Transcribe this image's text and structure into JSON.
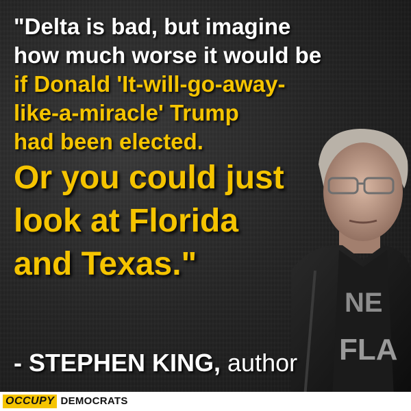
{
  "quote": {
    "lines": [
      "\"Delta is bad, but imagine",
      "how much worse it would be",
      "if Donald 'It-will-go-away-",
      "like-a-miracle' Trump",
      "had been elected."
    ],
    "emphasis": [
      "Or you could just",
      "look at Florida",
      "and Texas.\""
    ]
  },
  "attribution": {
    "name": "- STEPHEN KING,",
    "role": " author"
  },
  "portrait": {
    "shirt_text_1": "NE",
    "shirt_text_2": "FLA"
  },
  "footer": {
    "brand_highlight": "OCCUPY",
    "brand_rest": "DEMOCRATS"
  },
  "colors": {
    "accent": "#f5c400",
    "text": "#ffffff",
    "background": "#1e1e1e"
  }
}
